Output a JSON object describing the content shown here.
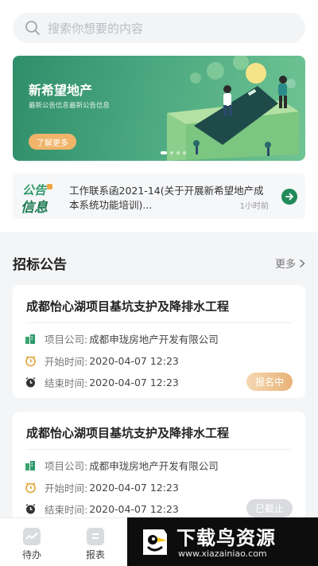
{
  "search": {
    "placeholder": "搜索你想要的内容"
  },
  "banner": {
    "title": "新希望地产",
    "subtitle": "最新公告信息最新公告信息",
    "button": "了解更多"
  },
  "notice": {
    "badge_line1": "公告",
    "badge_line2": "信息",
    "text": "工作联系函2021-14(关于开展新希望地产成本系统功能培训)...",
    "time": "1小时前"
  },
  "section": {
    "title": "招标公告",
    "more": "更多"
  },
  "cards": [
    {
      "title": "成都怡心湖项目基坑支护及降排水工程",
      "company_label": "项目公司:",
      "company": "成都申珑房地产开发有限公司",
      "start_label": "开始时间:",
      "start": "2020-04-07  12:23",
      "end_label": "结束时间:",
      "end": "2020-04-07  12:23",
      "status": "报名中"
    },
    {
      "title": "成都怡心湖项目基坑支护及降排水工程",
      "company_label": "项目公司:",
      "company": "成都申珑房地产开发有限公司",
      "start_label": "开始时间:",
      "start": "2020-04-07  12:23",
      "end_label": "结束时间:",
      "end": "2020-04-07  12:23",
      "status": "已截止"
    }
  ],
  "nav": [
    {
      "label": "待办",
      "icon": "todo-icon"
    },
    {
      "label": "报表",
      "icon": "report-icon"
    }
  ],
  "watermark": {
    "main": "下载鸟资源",
    "url": "www.xiazainiao.com"
  },
  "colors": {
    "brand_green": "#2f9a6b",
    "accent_orange": "#f0b46a"
  }
}
